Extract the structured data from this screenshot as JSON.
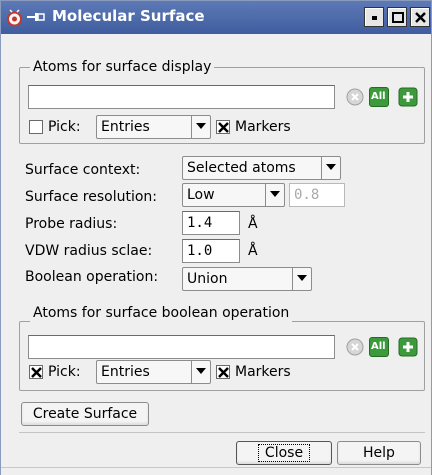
{
  "window": {
    "title": "Molecular Surface"
  },
  "display_group": {
    "legend": "Atoms for surface display",
    "atoms_value": "",
    "pick_label": "Pick:",
    "pick_checked": false,
    "entries_value": "Entries",
    "markers_label": "Markers",
    "markers_checked": true
  },
  "settings": {
    "surface_context_label": "Surface context:",
    "surface_context_value": "Selected atoms",
    "surface_resolution_label": "Surface resolution:",
    "surface_resolution_value": "Low",
    "resolution_number": "0.8",
    "probe_radius_label": "Probe radius:",
    "probe_radius_value": "1.4",
    "probe_radius_unit": "Å",
    "vdw_label": "VDW radius sclae:",
    "vdw_value": "1.0",
    "vdw_unit": "Å",
    "boolean_label": "Boolean operation:",
    "boolean_value": "Union"
  },
  "boolean_group": {
    "legend": "Atoms for surface boolean operation",
    "atoms_value": "",
    "pick_label": "Pick:",
    "pick_checked": true,
    "entries_value": "Entries",
    "markers_label": "Markers",
    "markers_checked": true
  },
  "buttons": {
    "create_surface": "Create Surface",
    "close": "Close",
    "help": "Help"
  },
  "icons": {
    "clear": "clear-icon",
    "all": "all-icon",
    "add": "plus-icon",
    "all_text": "All"
  },
  "colors": {
    "titlebar": "#4a68a8",
    "green_button": "#3c9a3c"
  }
}
